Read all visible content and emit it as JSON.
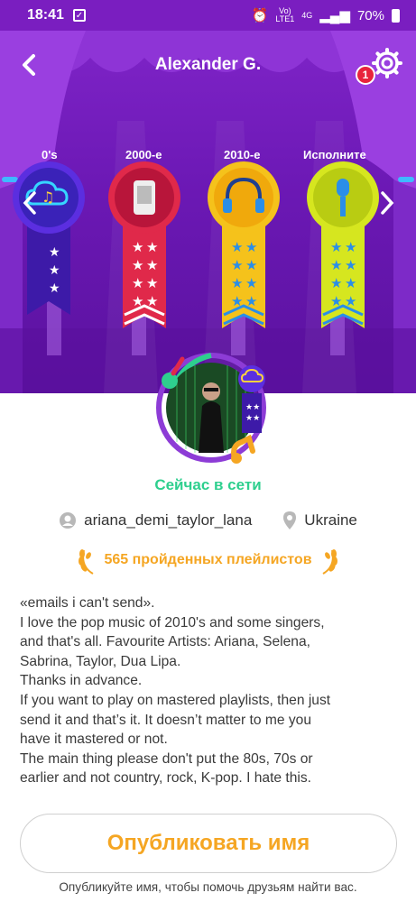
{
  "status_bar": {
    "time": "18:41",
    "network_top": "Vo)",
    "network_bottom": "LTE1",
    "network_type": "4G",
    "battery": "70%"
  },
  "header": {
    "title": "Alexander G.",
    "notification_count": "1"
  },
  "categories": [
    {
      "label": "0's",
      "icon": "music-cloud-icon",
      "color": "#4a2ad6",
      "stars": 3
    },
    {
      "label": "2000-e",
      "icon": "mp3-player-icon",
      "color": "#e0294a",
      "stars": 8
    },
    {
      "label": "2010-e",
      "icon": "headphones-icon",
      "color": "#f5c21b",
      "stars": 8
    },
    {
      "label": "Исполните",
      "icon": "microphone-icon",
      "color": "#d6e61f",
      "stars": 8
    }
  ],
  "profile": {
    "status": "Сейчас в сети",
    "username": "ariana_demi_taylor_lana",
    "location": "Ukraine",
    "playlists_completed": "565 пройденных плейлистов",
    "bio": "«emails i can't send».\nI love the pop music of 2010's and some singers,\nand that's all. Favourite Artists: Ariana, Selena,\nSabrina, Taylor, Dua Lipa.\nThanks in advance.\nIf you want to play on mastered playlists, then just\nsend it and that’s it. It doesn’t matter to me you\nhave it mastered or not.\nThe main thing please don't put the 80s, 70s or\nearlier and not country, rock, K-pop. I hate this."
  },
  "actions": {
    "publish_label": "Опубликовать имя",
    "publish_hint": "Опубликуйте имя, чтобы помочь друзьям найти вас."
  },
  "colors": {
    "accent": "#f5a623",
    "online": "#2ecf8e",
    "header_bg": "#7a1ec0"
  }
}
